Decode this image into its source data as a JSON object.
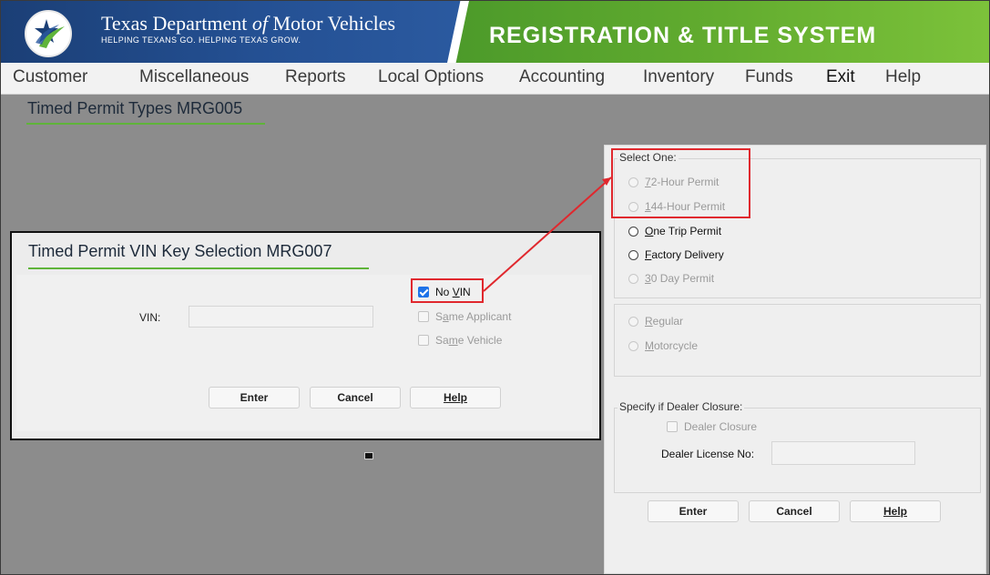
{
  "header": {
    "agency_prefix": "Texas Department ",
    "agency_of": "of",
    "agency_suffix": " Motor Vehicles",
    "tagline": "HELPING TEXANS GO. HELPING TEXAS GROW.",
    "system_title": "REGISTRATION & TITLE SYSTEM",
    "logo_icon": "star-logo-icon"
  },
  "menu": [
    "Customer",
    "Miscellaneous",
    "Reports",
    "Local Options",
    "Accounting",
    "Inventory",
    "Funds",
    "Exit",
    "Help"
  ],
  "page_title": "Timed Permit Types MRG005",
  "vin_dialog": {
    "title": "Timed Permit VIN Key Selection MRG007",
    "vin_label": "VIN:",
    "vin_value": "",
    "no_vin": {
      "pre": "No ",
      "u": "V",
      "post": "IN",
      "checked": true
    },
    "same_applicant": {
      "pre": "S",
      "u": "a",
      "post": "me Applicant",
      "checked": false
    },
    "same_vehicle": {
      "pre": "Sa",
      "u": "m",
      "post": "e Vehicle",
      "checked": false
    },
    "enter_label": "Enter",
    "cancel_label": "Cancel",
    "help_label": "Help"
  },
  "permit_panel": {
    "select_one_legend": "Select One:",
    "permit_options": [
      {
        "u": "7",
        "rest": "2-Hour Permit",
        "enabled": false
      },
      {
        "u": "1",
        "rest": "44-Hour Permit",
        "enabled": false
      },
      {
        "u": "O",
        "rest": "ne Trip Permit",
        "enabled": true
      },
      {
        "u": "F",
        "rest": "actory Delivery",
        "enabled": true
      },
      {
        "u": "3",
        "rest": "0 Day Permit",
        "enabled": false
      }
    ],
    "vehicle_options": [
      {
        "u": "R",
        "rest": "egular",
        "enabled": false
      },
      {
        "u": "M",
        "rest": "otorcycle",
        "enabled": false
      }
    ],
    "dealer_legend": "Specify if Dealer Closure:",
    "dealer_closure_label": "Dealer Closure",
    "dealer_license_label": "Dealer License No:",
    "dealer_license_value": "",
    "enter_label": "Enter",
    "cancel_label": "Cancel",
    "help_label": "Help"
  },
  "annotation_color": "#e0282e",
  "accent_green": "#5fb43a"
}
